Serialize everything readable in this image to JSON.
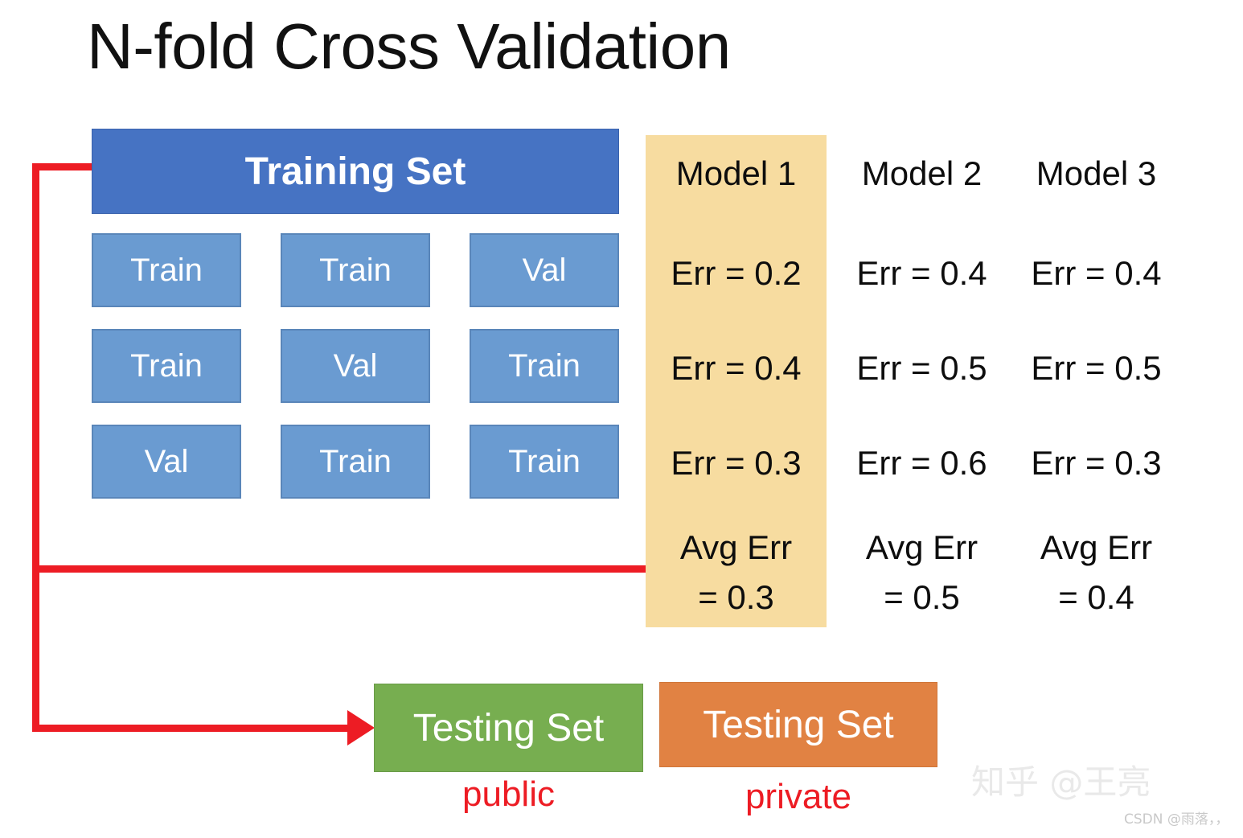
{
  "title": "N-fold Cross Validation",
  "training_set": {
    "label": "Training Set"
  },
  "folds": {
    "rows": [
      [
        {
          "label": "Train"
        },
        {
          "label": "Train"
        },
        {
          "label": "Val"
        }
      ],
      [
        {
          "label": "Train"
        },
        {
          "label": "Val"
        },
        {
          "label": "Train"
        }
      ],
      [
        {
          "label": "Val"
        },
        {
          "label": "Train"
        },
        {
          "label": "Train"
        }
      ]
    ]
  },
  "models": [
    {
      "name": "Model 1",
      "errors": [
        "Err = 0.2",
        "Err = 0.4",
        "Err = 0.3"
      ],
      "avg_label": "Avg Err",
      "avg_value": "= 0.3",
      "highlighted": true
    },
    {
      "name": "Model 2",
      "errors": [
        "Err = 0.4",
        "Err = 0.5",
        "Err = 0.6"
      ],
      "avg_label": "Avg Err",
      "avg_value": "= 0.5",
      "highlighted": false
    },
    {
      "name": "Model 3",
      "errors": [
        "Err = 0.4",
        "Err = 0.5",
        "Err = 0.3"
      ],
      "avg_label": "Avg Err",
      "avg_value": "= 0.4",
      "highlighted": false
    }
  ],
  "testing": {
    "public": {
      "label": "Testing Set",
      "caption": "public"
    },
    "private": {
      "label": "Testing Set",
      "caption": "private"
    }
  },
  "watermarks": {
    "zhihu": "知乎 @王亮",
    "csdn": "CSDN @雨落，，"
  },
  "colors": {
    "training_set_blue": "#4673C3",
    "fold_blue": "#6A9BD1",
    "highlight_tan": "#F7DCA0",
    "testing_public_green": "#77AE50",
    "testing_private_orange": "#E18243",
    "connector_red": "#ED1C24"
  }
}
